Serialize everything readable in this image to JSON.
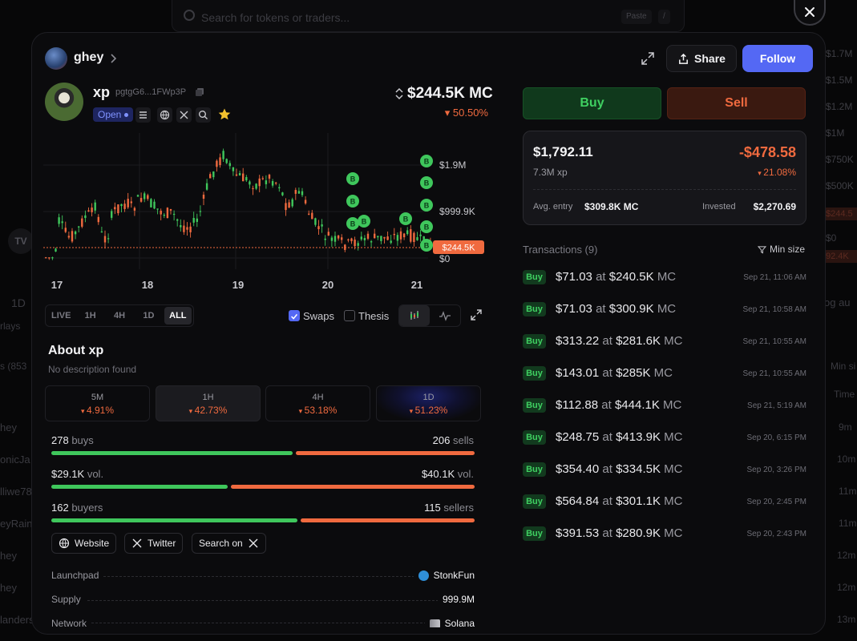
{
  "background": {
    "search_placeholder": "Search for tokens or traders...",
    "paste_label": "Paste",
    "slash_label": "/",
    "right_labels": [
      "$1.7M",
      "$1.5M",
      "$1.2M",
      "$1M",
      "$750K",
      "$500K"
    ],
    "right_tag_1": "$244.5",
    "right_zero": "$0",
    "right_tag_2": "92.4K",
    "left_1d": "1D",
    "left_overlays": "rlays",
    "left_count": "s (853",
    "left_names": [
      "hey",
      "onicJa",
      "lliwe78",
      "eyRainy",
      "hey",
      "hey",
      "landers"
    ],
    "right_minsize": "Min si",
    "right_time": "Time",
    "right_times": [
      "9m",
      "10m",
      "11m",
      "11m",
      "12m",
      "12m",
      "13m"
    ],
    "right_log": "og  au",
    "tv_logo": "TV"
  },
  "header": {
    "user_name": "ghey",
    "share_label": "Share",
    "follow_label": "Follow"
  },
  "token": {
    "name": "xp",
    "address": "pgtgG6...1FWp3P",
    "status": "Open",
    "market_cap": "$244.5K MC",
    "change": "▾ 50.50%"
  },
  "chart_data": {
    "type": "candlestick",
    "x_labels": [
      "17",
      "18",
      "19",
      "20",
      "21"
    ],
    "y_labels": [
      "$1.9M",
      "$999.9K",
      "$0"
    ],
    "current_price_label": "$244.5K",
    "trade_markers": [
      "B",
      "B",
      "B",
      "B",
      "B",
      "B",
      "B",
      "B",
      "B",
      "B"
    ]
  },
  "chart_controls": {
    "timeframes": [
      "LIVE",
      "1H",
      "4H",
      "1D",
      "ALL"
    ],
    "active_timeframe": "ALL",
    "swaps_label": "Swaps",
    "thesis_label": "Thesis"
  },
  "about": {
    "title": "About xp",
    "description": "No description found",
    "periods": [
      {
        "label": "5M",
        "value": "4.91%"
      },
      {
        "label": "1H",
        "value": "42.73%"
      },
      {
        "label": "4H",
        "value": "53.18%"
      },
      {
        "label": "1D",
        "value": "51.23%"
      }
    ],
    "buys_count": "278",
    "buys_label": "buys",
    "sells_count": "206",
    "sells_label": "sells",
    "buys_fraction": 0.574,
    "buy_vol": "$29.1K",
    "sell_vol": "$40.1K",
    "vol_label": "vol.",
    "buy_vol_fraction": 0.42,
    "buyers_count": "162",
    "buyers_label": "buyers",
    "sellers_count": "115",
    "sellers_label": "sellers",
    "buyers_fraction": 0.585,
    "links": {
      "website": "Website",
      "twitter": "Twitter",
      "search": "Search on"
    },
    "launchpad_label": "Launchpad",
    "launchpad_value": "StonkFun",
    "supply_label": "Supply",
    "supply_value": "999.9M",
    "network_label": "Network",
    "network_value": "Solana"
  },
  "trade": {
    "buy_label": "Buy",
    "sell_label": "Sell"
  },
  "position": {
    "value": "$1,792.11",
    "amount": "7.3M xp",
    "pnl": "-$478.58",
    "pnl_pct": "21.08%",
    "avg_entry_label": "Avg. entry",
    "avg_entry_value": "$309.8K MC",
    "invested_label": "Invested",
    "invested_value": "$2,270.69"
  },
  "transactions": {
    "title": "Transactions (9)",
    "min_size_label": "Min size",
    "at_label": "at",
    "mc_label": "MC",
    "items": [
      {
        "type": "Buy",
        "amount": "$71.03",
        "mc": "$240.5K",
        "time": "Sep 21, 11:06 AM"
      },
      {
        "type": "Buy",
        "amount": "$71.03",
        "mc": "$300.9K",
        "time": "Sep 21, 10:58 AM"
      },
      {
        "type": "Buy",
        "amount": "$313.22",
        "mc": "$281.6K",
        "time": "Sep 21, 10:55 AM"
      },
      {
        "type": "Buy",
        "amount": "$143.01",
        "mc": "$285K",
        "time": "Sep 21, 10:55 AM"
      },
      {
        "type": "Buy",
        "amount": "$112.88",
        "mc": "$444.1K",
        "time": "Sep 21, 5:19 AM"
      },
      {
        "type": "Buy",
        "amount": "$248.75",
        "mc": "$413.9K",
        "time": "Sep 20, 6:15 PM"
      },
      {
        "type": "Buy",
        "amount": "$354.40",
        "mc": "$334.5K",
        "time": "Sep 20, 3:26 PM"
      },
      {
        "type": "Buy",
        "amount": "$564.84",
        "mc": "$301.1K",
        "time": "Sep 20, 2:45 PM"
      },
      {
        "type": "Buy",
        "amount": "$391.53",
        "mc": "$280.9K",
        "time": "Sep 20, 2:43 PM"
      }
    ]
  },
  "colors": {
    "accent": "#5468f4",
    "up": "#3fc75c",
    "down": "#f06a3f"
  }
}
